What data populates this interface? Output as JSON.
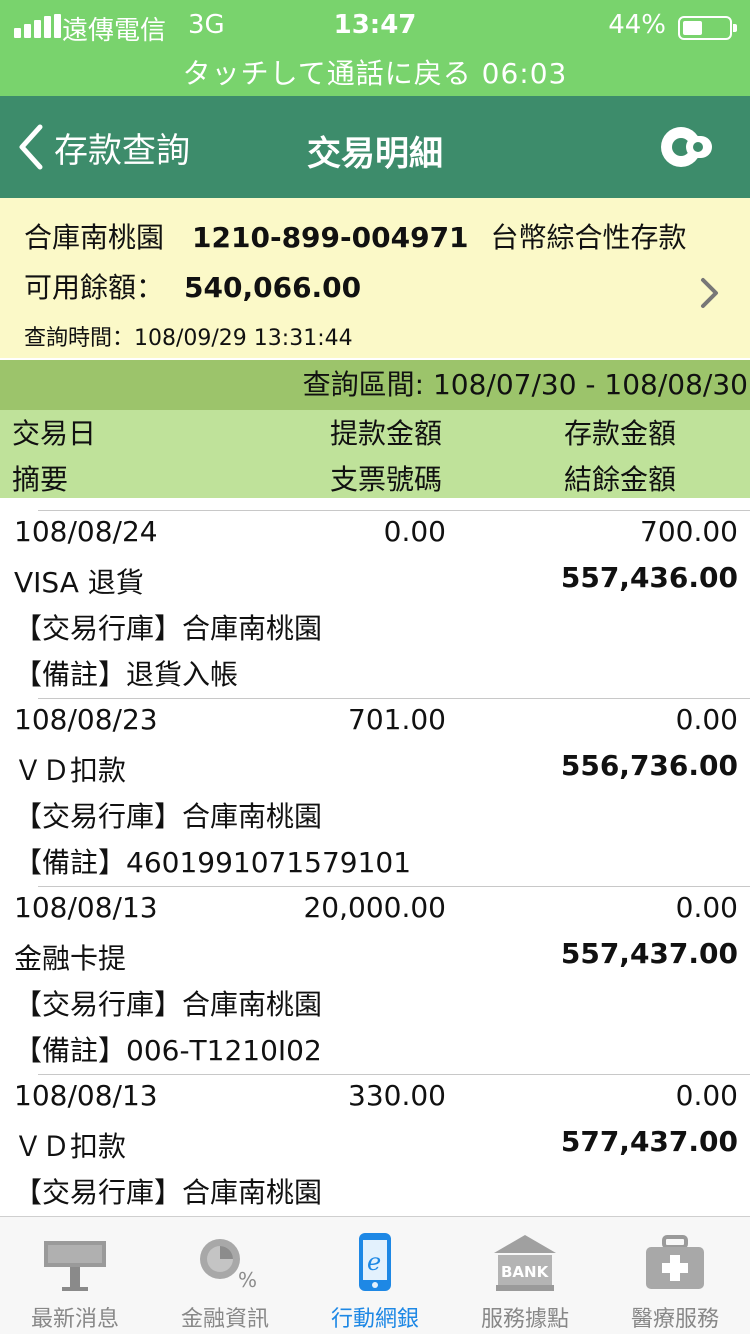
{
  "status_bar": {
    "carrier": "遠傳電信",
    "network": "3G",
    "time": "13:47",
    "battery": "44%",
    "battery_level": 0.44,
    "call_banner": "タッチして通話に戻る 06:03"
  },
  "nav": {
    "back_label": "存款查詢",
    "title": "交易明細"
  },
  "account": {
    "branch": "合庫南桃園",
    "number": "1210-899-004971",
    "type": "台幣綜合性存款",
    "available_label": "可用餘額：",
    "available_amount": "540,066.00",
    "query_time": "查詢時間：108/09/29 13:31:44"
  },
  "query_range": "查詢區間: 108/07/30 - 108/08/30",
  "columns": {
    "date": "交易日",
    "withdraw": "提款金額",
    "deposit": "存款金額",
    "summary": "摘要",
    "check_no": "支票號碼",
    "balance": "結餘金額"
  },
  "transactions": [
    {
      "date": "108/08/24",
      "withdraw": "0.00",
      "deposit": "700.00",
      "desc": "VISA 退貨",
      "balance": "557,436.00",
      "branch": "【交易行庫】合庫南桃園",
      "note": "【備註】退貨入帳"
    },
    {
      "date": "108/08/23",
      "withdraw": "701.00",
      "deposit": "0.00",
      "desc": "ＶＤ扣款",
      "balance": "556,736.00",
      "branch": "【交易行庫】合庫南桃園",
      "note": "【備註】4601991071579101"
    },
    {
      "date": "108/08/13",
      "withdraw": "20,000.00",
      "deposit": "0.00",
      "desc": "金融卡提",
      "balance": "557,437.00",
      "branch": "【交易行庫】合庫南桃園",
      "note": "【備註】006-T1210I02"
    },
    {
      "date": "108/08/13",
      "withdraw": "330.00",
      "deposit": "0.00",
      "desc": "ＶＤ扣款",
      "balance": "577,437.00",
      "branch": "【交易行庫】合庫南桃園",
      "note": ""
    }
  ],
  "tabs": [
    {
      "label": "最新消息",
      "icon": "news-board-icon"
    },
    {
      "label": "金融資訊",
      "icon": "finance-info-icon"
    },
    {
      "label": "行動網銀",
      "icon": "mobile-banking-icon",
      "active": true
    },
    {
      "label": "服務據點",
      "icon": "bank-branch-icon"
    },
    {
      "label": "醫療服務",
      "icon": "medical-kit-icon"
    }
  ],
  "colors": {
    "status_green": "#79d36d",
    "nav_green": "#3d8c6b",
    "account_bg": "#fbf9c8",
    "range_bg": "#9cc46b",
    "header_bg": "#bfe29a",
    "active_tab": "#1e88e5"
  }
}
